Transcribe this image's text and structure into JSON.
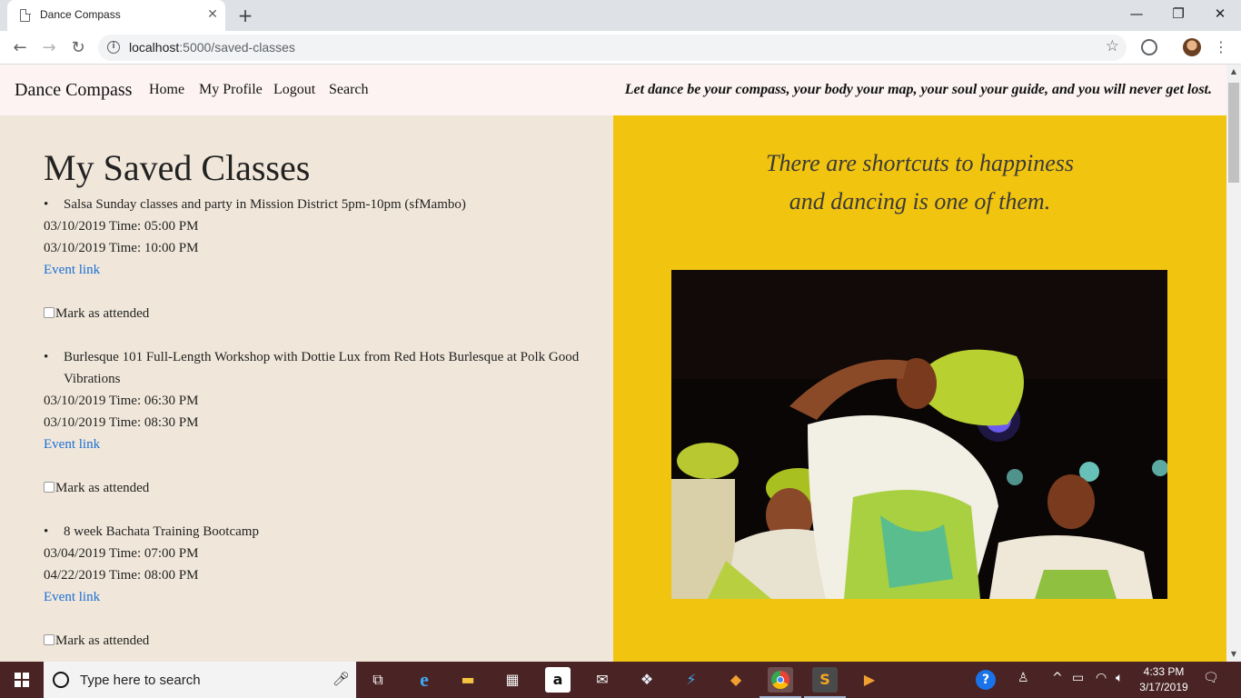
{
  "browser": {
    "tab_title": "Dance Compass",
    "tab_close": "✕",
    "new_tab": "+",
    "url_host": "localhost",
    "url_path": ":5000/saved-classes",
    "window_controls": {
      "minimize": "—",
      "restore": "❐",
      "close": "✕"
    },
    "nav": {
      "back": "←",
      "forward": "→",
      "reload": "↻"
    },
    "bookmark_star": "☆",
    "menu": "⋮"
  },
  "site": {
    "brand": "Dance Compass",
    "nav_links": [
      "Home",
      "My Profile",
      "Logout",
      "Search"
    ],
    "tagline": "Let dance be your compass, your body your map, your soul your guide, and you will never get lost."
  },
  "saved_classes": {
    "title": "My Saved Classes",
    "event_link_label": "Event link",
    "attended_label": "Mark as attended",
    "items": [
      {
        "name": "Salsa Sunday classes and party in Mission District 5pm-10pm (sfMambo)",
        "start": "03/10/2019 Time: 05:00 PM",
        "end": "03/10/2019 Time: 10:00 PM"
      },
      {
        "name": "Burlesque 101 Full-Length Workshop with Dottie Lux from Red Hots Burlesque at Polk Good Vibrations",
        "start": "03/10/2019 Time: 06:30 PM",
        "end": "03/10/2019 Time: 08:30 PM"
      },
      {
        "name": "8 week Bachata Training Bootcamp",
        "start": "03/04/2019 Time: 07:00 PM",
        "end": "04/22/2019 Time: 08:00 PM"
      }
    ]
  },
  "quote": {
    "line1": "There are shortcuts to happiness",
    "line2": "and dancing is one of them."
  },
  "taskbar": {
    "search_placeholder": "Type here to search",
    "time": "4:33 PM",
    "date": "3/17/2019"
  },
  "colors": {
    "left_bg": "#f0e7da",
    "right_bg": "#f1c40f",
    "nav_bg": "#fdf3f3",
    "link": "#1a6fd6",
    "taskbar": "#4a2424"
  }
}
